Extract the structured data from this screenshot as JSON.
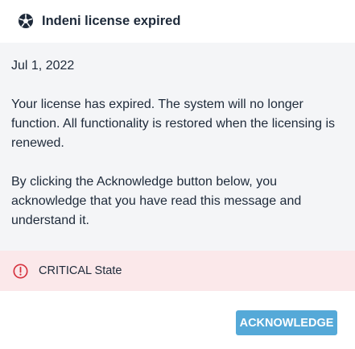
{
  "dialog": {
    "title": "Indeni license expired",
    "title_icon": "soccer-ball-icon"
  },
  "message": {
    "date": "Jul 1, 2022",
    "paragraph_1": "Your license has expired. The system will no longer function. All functionality is restored when the licensing is renewed.",
    "paragraph_2": "By clicking the Acknowledge button below, you acknowledge that you have read this message and understand it."
  },
  "state": {
    "icon": "alert-circle-icon",
    "label": "CRITICAL State",
    "color": "#d6333f",
    "background": "#fbe8ea"
  },
  "footer": {
    "acknowledge_label": "ACKNOWLEDGE",
    "button_color": "#55a9d8"
  }
}
